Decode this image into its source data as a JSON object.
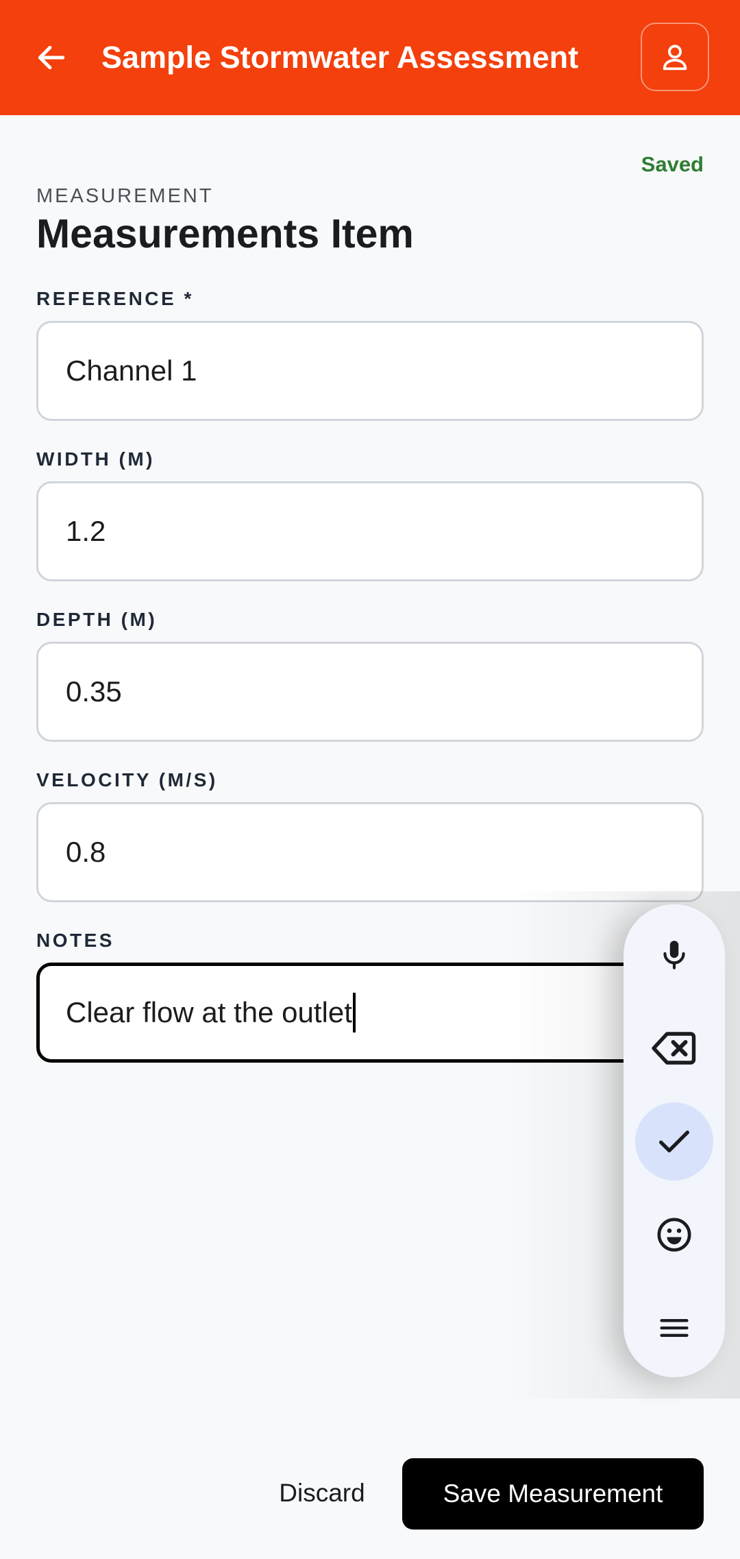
{
  "header": {
    "title": "Sample Stormwater Assessment",
    "back_icon": "arrow-left-icon",
    "profile_icon": "person-icon",
    "background_color": "#f4400c"
  },
  "status": {
    "saved_text": "Saved",
    "color": "#2e7d32"
  },
  "form": {
    "overline": "MEASUREMENT",
    "title": "Measurements Item",
    "fields": [
      {
        "label": "REFERENCE *",
        "value": "Channel 1"
      },
      {
        "label": "WIDTH (M)",
        "value": "1.2"
      },
      {
        "label": "DEPTH (M)",
        "value": "0.35"
      },
      {
        "label": "VELOCITY (M/S)",
        "value": "0.8"
      },
      {
        "label": "NOTES",
        "value": "Clear flow at the outlet"
      }
    ]
  },
  "keyboard_toolbar": {
    "buttons": [
      {
        "icon": "microphone-icon"
      },
      {
        "icon": "backspace-icon"
      },
      {
        "icon": "check-icon",
        "selected": true
      },
      {
        "icon": "emoji-icon"
      },
      {
        "icon": "menu-icon"
      }
    ]
  },
  "actions": {
    "discard_label": "Discard",
    "save_label": "Save Measurement"
  }
}
